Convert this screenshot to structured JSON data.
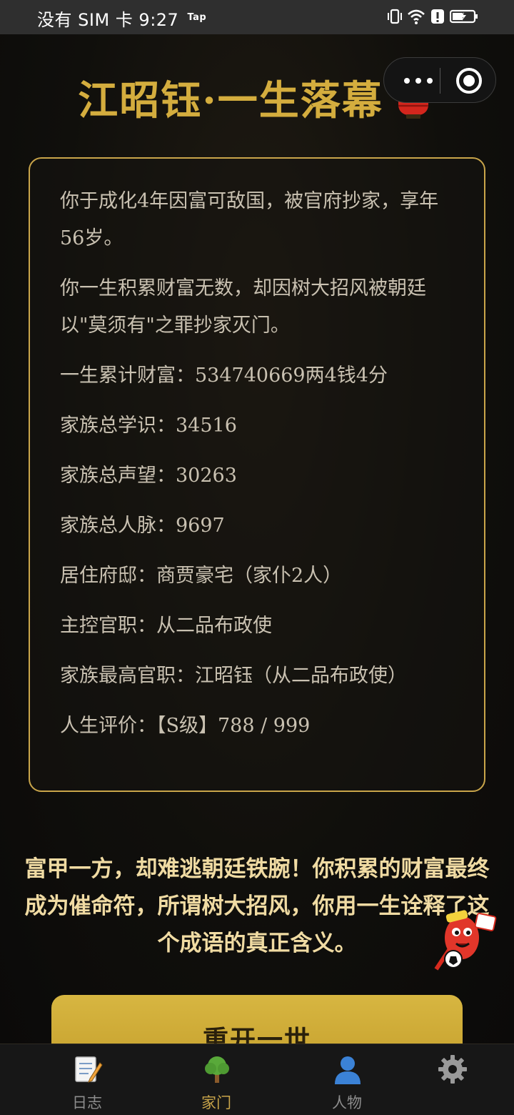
{
  "status_bar": {
    "carrier": "没有 SIM 卡",
    "time": "9:27",
    "tap_badge": "Tap",
    "icons": [
      "vibrate-icon",
      "wifi-icon",
      "alert-icon",
      "battery-charging-icon"
    ]
  },
  "header": {
    "title": "江昭钰·一生落幕",
    "title_color": "#d4ad3e",
    "emoji_icon": "lantern-icon"
  },
  "capsule": {
    "more_icon": "more-dots-icon",
    "close_icon": "target-close-icon"
  },
  "summary_card": {
    "border_color": "#c9a54a",
    "lines": [
      "你于成化4年因富可敌国，被官府抄家，享年56岁。",
      "你一生积累财富无数，却因树大招风被朝廷以\"莫须有\"之罪抄家灭门。",
      "一生累计财富：534740669两4钱4分",
      "家族总学识：34516",
      "家族总声望：30263",
      "家族总人脉：9697",
      "居住府邸：商贾豪宅（家仆2人）",
      "主控官职：从二品布政使",
      "家族最高官职：江昭钰（从二品布政使）",
      "人生评价：【S级】788 / 999"
    ]
  },
  "verdict": "富甲一方，却难逃朝廷铁腕！你积累的财富最终成为催命符，所谓树大招风，你用一生诠释了这个成语的真正含义。",
  "restart_button": {
    "label": "重开一世",
    "color": "#d2b03b"
  },
  "tabbar": {
    "active_color": "#c9a54a",
    "tabs": [
      {
        "label": "日志",
        "icon": "memo-icon",
        "active": false
      },
      {
        "label": "家门",
        "icon": "tree-icon",
        "active": true
      },
      {
        "label": "人物",
        "icon": "person-icon",
        "active": false
      },
      {
        "label": "",
        "icon": "gear-icon",
        "active": false
      }
    ]
  }
}
